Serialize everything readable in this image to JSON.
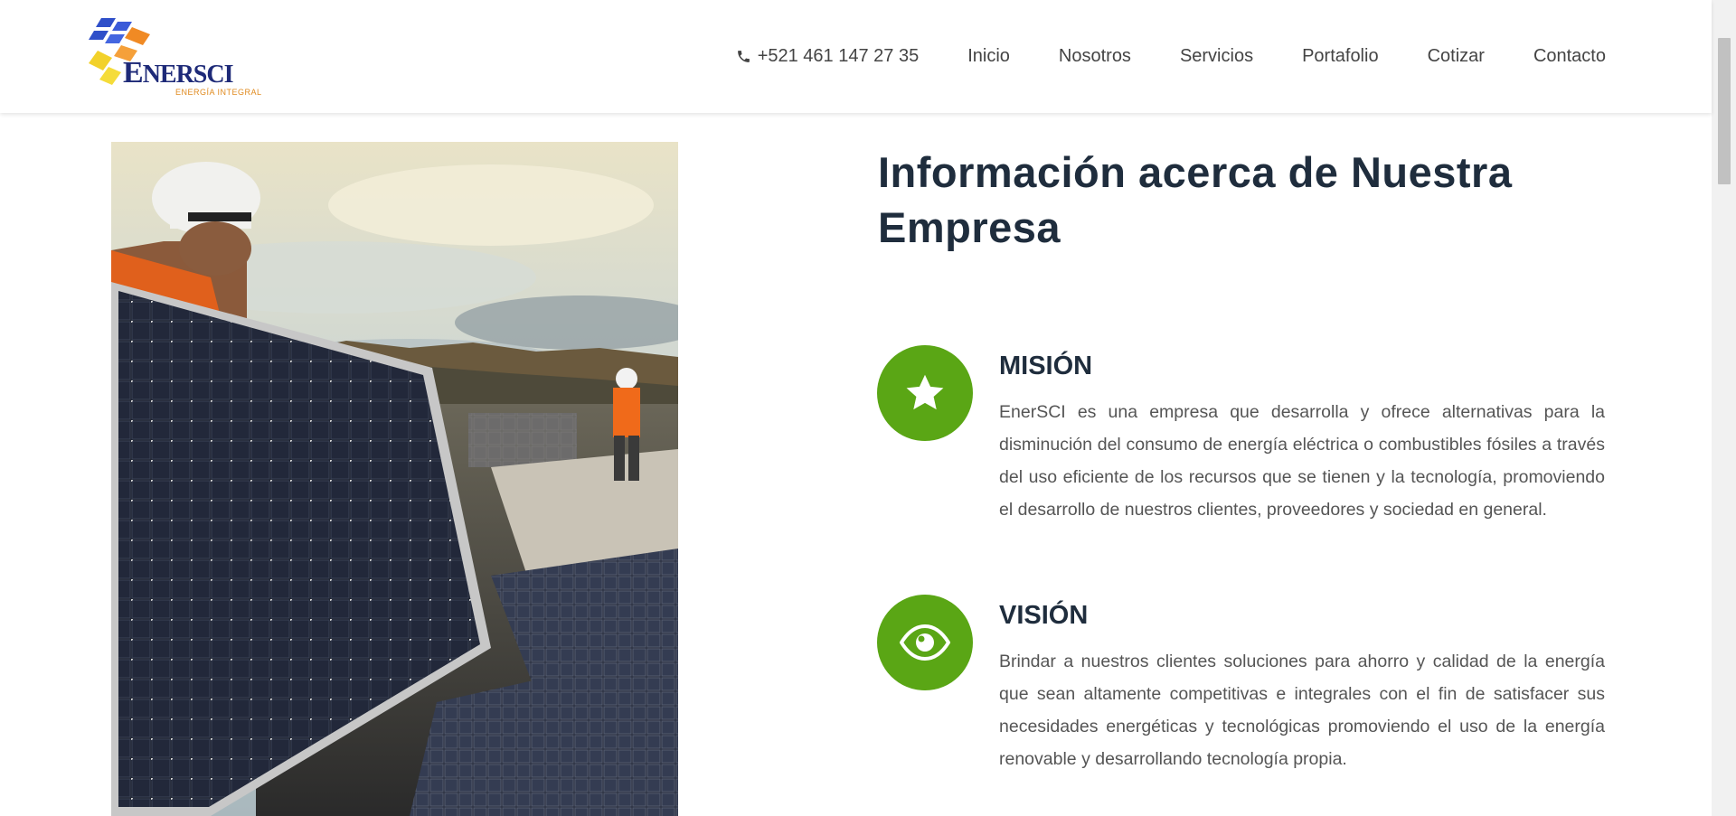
{
  "brand": {
    "name_big": "E",
    "name_rest": "NERSCI",
    "tagline": "ENERGÍA INTEGRAL",
    "colors": {
      "navy": "#1e2a78",
      "blue": "#2f4fc9",
      "orange": "#f08a24",
      "yellow": "#f2d12a"
    }
  },
  "nav": {
    "phone": "+521 461 147 27 35",
    "phone_icon": "phone-icon",
    "items": [
      {
        "label": "Inicio"
      },
      {
        "label": "Nosotros"
      },
      {
        "label": "Servicios"
      },
      {
        "label": "Portafolio"
      },
      {
        "label": "Cotizar"
      },
      {
        "label": "Contacto"
      }
    ]
  },
  "about": {
    "heading": "Información acerca de Nuestra Empresa",
    "accent_color": "#5aa615",
    "mision": {
      "title": "MISIÓN",
      "icon": "star-icon",
      "text": "EnerSCI es una empresa que desarrolla y ofrece alternativas para la disminución del consumo de energía eléctrica o combustibles fósiles a través del uso eficiente de los recursos que se tienen y la tecnología, promoviendo el desarrollo de nuestros clientes, proveedores y sociedad en general."
    },
    "vision": {
      "title": "VISIÓN",
      "icon": "eye-icon",
      "text": "Brindar a nuestros clientes soluciones para ahorro y calidad de la energía que sean altamente competitivas e integrales con el fin de satisfacer sus necesidades energéticas y tecnológicas promoviendo el uso de la energía renovable y desarrollando tecnología propia."
    }
  }
}
